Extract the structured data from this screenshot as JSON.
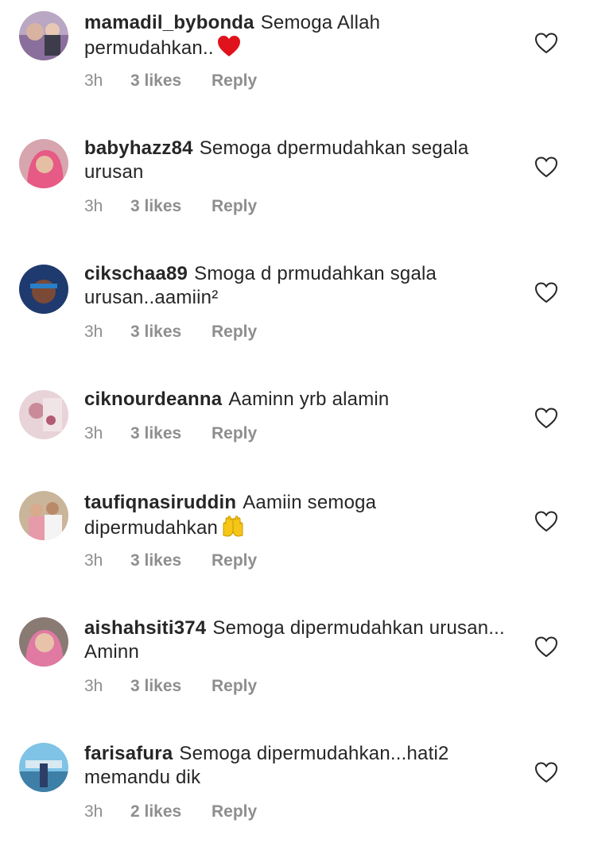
{
  "comments": [
    {
      "username": "mamadil_bybonda",
      "text": "Semoga Allah permudahkan..",
      "emoji": "heart-emoji",
      "time": "3h",
      "likes": "3 likes",
      "reply": "Reply"
    },
    {
      "username": "babyhazz84",
      "text": "Semoga dpermudahkan segala urusan",
      "time": "3h",
      "likes": "3 likes",
      "reply": "Reply"
    },
    {
      "username": "cikschaa89",
      "text": "Smoga d prmudahkan sgala urusan..aamiin²",
      "time": "3h",
      "likes": "3 likes",
      "reply": "Reply"
    },
    {
      "username": "ciknourdeanna",
      "text": "Aaminn yrb alamin",
      "time": "3h",
      "likes": "3 likes",
      "reply": "Reply"
    },
    {
      "username": "taufiqnasiruddin",
      "text": "Aamiin semoga dipermudahkan",
      "emoji": "raised-hands-emoji",
      "time": "3h",
      "likes": "3 likes",
      "reply": "Reply"
    },
    {
      "username": "aishahsiti374",
      "text": "Semoga dipermudahkan urusan... Aminn",
      "time": "3h",
      "likes": "3 likes",
      "reply": "Reply"
    },
    {
      "username": "farisafura",
      "text": "Semoga dipermudahkan...hati2 memandu dik",
      "time": "3h",
      "likes": "2 likes",
      "reply": "Reply"
    }
  ],
  "colors": {
    "text": "#262626",
    "meta": "#8e8e8e",
    "heart": "#262626",
    "emoji_heart": "#e0121b",
    "emoji_hands": "#f5c518"
  }
}
